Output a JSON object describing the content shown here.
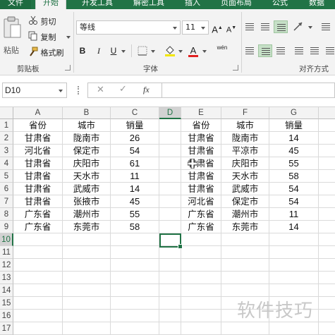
{
  "ribbon_tabs": [
    "文件",
    "开始",
    "开发工具",
    "解密工具",
    "插入",
    "页面布局",
    "公式",
    "数据"
  ],
  "active_tab": "开始",
  "clipboard": {
    "paste_label": "粘贴",
    "cut_label": "剪切",
    "copy_label": "复制",
    "format_painter_label": "格式刷",
    "group_label": "剪贴板"
  },
  "font": {
    "font_name": "等线",
    "font_size": "11",
    "bold": "B",
    "italic": "I",
    "underline": "U",
    "grow": "A",
    "shrink": "A",
    "font_color_letter": "A",
    "phonetic_char": "wén",
    "group_label": "字体",
    "font_color": "#e02020"
  },
  "alignment": {
    "group_label": "对齐方式"
  },
  "formula_bar": {
    "name_box": "D10",
    "fx_label": "fx",
    "formula": ""
  },
  "columns": [
    "A",
    "B",
    "C",
    "D",
    "E",
    "F",
    "G"
  ],
  "selected_column": "D",
  "rows": [
    "1",
    "2",
    "3",
    "4",
    "5",
    "6",
    "7",
    "8",
    "9",
    "10",
    "11",
    "12",
    "13",
    "14",
    "15",
    "16",
    "17"
  ],
  "selected_row": "10",
  "table_left": {
    "headers": [
      "省份",
      "城市",
      "销量"
    ],
    "rows": [
      [
        "甘肃省",
        "陇南市",
        "26"
      ],
      [
        "河北省",
        "保定市",
        "54"
      ],
      [
        "甘肃省",
        "庆阳市",
        "61"
      ],
      [
        "甘肃省",
        "天水市",
        "11"
      ],
      [
        "甘肃省",
        "武威市",
        "14"
      ],
      [
        "甘肃省",
        "张掖市",
        "45"
      ],
      [
        "广东省",
        "潮州市",
        "55"
      ],
      [
        "广东省",
        "东莞市",
        "58"
      ]
    ]
  },
  "table_right": {
    "headers": [
      "省份",
      "城市",
      "销量"
    ],
    "rows": [
      [
        "甘肃省",
        "陇南市",
        "14"
      ],
      [
        "甘肃省",
        "平凉市",
        "45"
      ],
      [
        "甘肃省",
        "庆阳市",
        "55"
      ],
      [
        "甘肃省",
        "天水市",
        "58"
      ],
      [
        "甘肃省",
        "武威市",
        "54"
      ],
      [
        "河北省",
        "保定市",
        "54"
      ],
      [
        "广东省",
        "潮州市",
        "11"
      ],
      [
        "广东省",
        "东莞市",
        "14"
      ]
    ]
  },
  "watermark": "软件技巧",
  "accent_color": "#217346"
}
